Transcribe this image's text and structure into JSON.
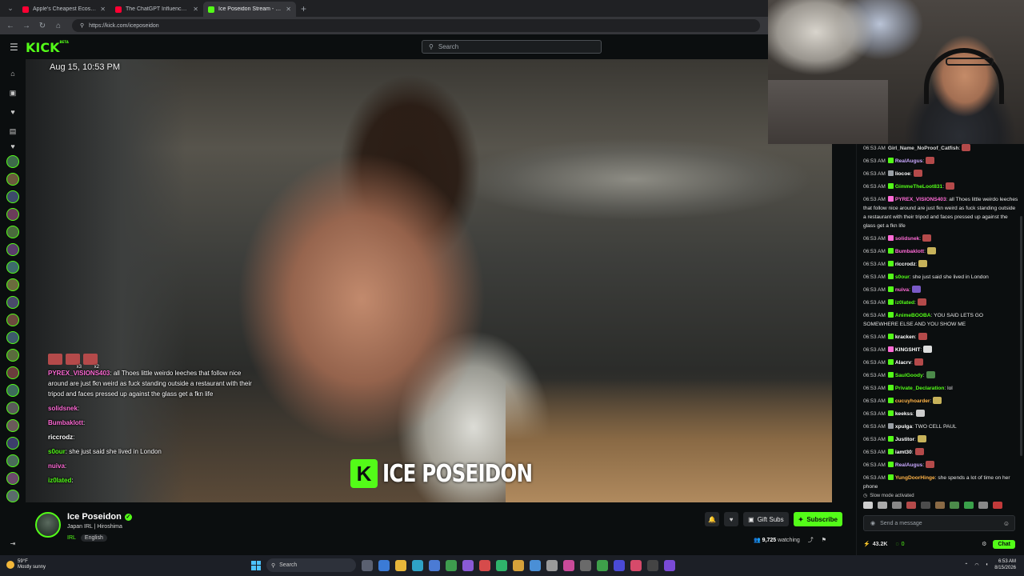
{
  "browser": {
    "tabs": [
      {
        "title": "Apple's Cheapest Ecosystem Endi...",
        "favicon_color": "#ff0033",
        "active": false
      },
      {
        "title": "The ChatGPT Influencer Trap Just...",
        "favicon_color": "#ff0033",
        "active": false
      },
      {
        "title": "Ice Poseidon Stream - Watch ...",
        "favicon_color": "#53fc18",
        "active": true
      }
    ],
    "new_tab_icon": "+",
    "url": "https://kick.com/iceposeidon"
  },
  "kick": {
    "logo": "KICK",
    "logo_sup": "BETA",
    "search_placeholder": "Search",
    "accent": "#53fc18"
  },
  "video": {
    "date_overlay": "Aug 15, 10:53 PM",
    "watermark": "ICE POSEIDON",
    "overlay_chat": [
      {
        "user": "PYREX_VISIONS403",
        "color": "#ff6bd6",
        "text": ": all Thoes little weirdo leeches that follow nice around are just fkn weird as fuck standing outside a restaurant with their tripod and faces pressed up against the glass get a fkn life"
      },
      {
        "user": "solidsnek",
        "color": "#ff6bd6",
        "text": ":"
      },
      {
        "user": "Bumbaklott",
        "color": "#ff6bd6",
        "text": ":"
      },
      {
        "user": "riccrodz",
        "color": "#ffffff",
        "text": ":"
      },
      {
        "user": "s0our",
        "color": "#53fc18",
        "text": ": she just said she lived in London"
      },
      {
        "user": "nuiva",
        "color": "#ff6bd6",
        "text": ":"
      },
      {
        "user": "iz0lated",
        "color": "#53fc18",
        "text": ":"
      }
    ],
    "overlay_emote_counts": [
      "x3",
      "x2"
    ]
  },
  "stream": {
    "name": "Ice Poseidon",
    "title": "Japan IRL | Hiroshima",
    "category": "IRL",
    "tag": "English",
    "gift_label": "Gift Subs",
    "subscribe_label": "Subscribe",
    "watching_count": "9,725",
    "watching_label": "watching"
  },
  "chat": {
    "messages": [
      {
        "ts": "06:53 AM",
        "user": "Girl_Name_NoProof_Catfish",
        "color": "#d6d6d6",
        "badge": "",
        "text": ":",
        "emote": "#b44a4a"
      },
      {
        "ts": "06:53 AM",
        "user": "RealAugus",
        "color": "#c9a9ff",
        "badge": "#53fc18",
        "text": ":",
        "emote": "#b44a4a"
      },
      {
        "ts": "06:53 AM",
        "user": "liocoe",
        "color": "#ffffff",
        "badge": "#9aa0a6",
        "text": ":",
        "emote": "#b44a4a"
      },
      {
        "ts": "06:53 AM",
        "user": "GimmeTheLoot831",
        "color": "#53fc18",
        "badge": "#53fc18",
        "text": ":",
        "emote": "#b44a4a"
      },
      {
        "ts": "06:53 AM",
        "user": "PYREX_VISIONS403",
        "color": "#ff6bd6",
        "badge": "#ff6bd6",
        "text": ": all Thoes little weirdo leeches that follow nice around are just fkn weird as fuck standing outside a restaurant with their tripod and faces pressed up against the glass get a fkn life",
        "emote": ""
      },
      {
        "ts": "06:53 AM",
        "user": "solidsnek",
        "color": "#ff6bd6",
        "badge": "#ff6bd6",
        "text": ":",
        "emote": "#b44a4a"
      },
      {
        "ts": "06:53 AM",
        "user": "Bumbaklott",
        "color": "#ff6bd6",
        "badge": "#53fc18",
        "text": ":",
        "emote": "#c7b25a"
      },
      {
        "ts": "06:53 AM",
        "user": "riccrodz",
        "color": "#ffffff",
        "badge": "#53fc18",
        "text": ":",
        "emote": "#c7b25a"
      },
      {
        "ts": "06:53 AM",
        "user": "s0our",
        "color": "#53fc18",
        "badge": "#53fc18",
        "text": ": she just said she lived in London",
        "emote": ""
      },
      {
        "ts": "06:53 AM",
        "user": "nuiva",
        "color": "#ff6bd6",
        "badge": "#53fc18",
        "text": ":",
        "emote": "#7a5ac7"
      },
      {
        "ts": "06:53 AM",
        "user": "iz0lated",
        "color": "#53fc18",
        "badge": "#53fc18",
        "text": ":",
        "emote": "#b44a4a"
      },
      {
        "ts": "06:53 AM",
        "user": "AnimeBOOBA",
        "color": "#53fc18",
        "badge": "#53fc18",
        "text": ": YOU SAID LETS GO SOMEWHERE ELSE AND YOU SHOW ME",
        "emote": ""
      },
      {
        "ts": "06:53 AM",
        "user": "kracken",
        "color": "#ffffff",
        "badge": "#53fc18",
        "text": ":",
        "emote": "#b44a4a"
      },
      {
        "ts": "06:53 AM",
        "user": "KINGSHIT",
        "color": "#ffffff",
        "badge": "#ff6bd6",
        "text": ":",
        "emote": "#dddddd"
      },
      {
        "ts": "06:53 AM",
        "user": "Alacrv",
        "color": "#ffffff",
        "badge": "#53fc18",
        "text": ":",
        "emote": "#b44a4a"
      },
      {
        "ts": "06:53 AM",
        "user": "SaulGoody",
        "color": "#53fc18",
        "badge": "#53fc18",
        "text": ":",
        "emote": "#4c8a4a"
      },
      {
        "ts": "06:53 AM",
        "user": "Private_Declaration",
        "color": "#53fc18",
        "badge": "#53fc18",
        "text": ": lol",
        "emote": ""
      },
      {
        "ts": "06:53 AM",
        "user": "cucuyhoarder",
        "color": "#ffb347",
        "badge": "#53fc18",
        "text": ":",
        "emote": "#c7b25a"
      },
      {
        "ts": "06:53 AM",
        "user": "keekss",
        "color": "#ffffff",
        "badge": "#53fc18",
        "text": ":",
        "emote": "#cccccc"
      },
      {
        "ts": "06:53 AM",
        "user": "xpulga",
        "color": "#ffffff",
        "badge": "#9aa0a6",
        "text": ": TWO CELL PAUL",
        "emote": ""
      },
      {
        "ts": "06:53 AM",
        "user": "Justitor",
        "color": "#ffffff",
        "badge": "#53fc18",
        "text": ":",
        "emote": "#c7b25a"
      },
      {
        "ts": "06:53 AM",
        "user": "iamt30",
        "color": "#ffffff",
        "badge": "#53fc18",
        "text": ":",
        "emote": "#b44a4a"
      },
      {
        "ts": "06:53 AM",
        "user": "RealAugus",
        "color": "#c9a9ff",
        "badge": "#53fc18",
        "text": ":",
        "emote": "#b44a4a"
      },
      {
        "ts": "06:53 AM",
        "user": "YungDoorHinge",
        "color": "#ffb347",
        "badge": "#53fc18",
        "text": ": she spends a lot of time on her phone",
        "emote": ""
      }
    ],
    "slow_mode_label": "Slow mode activated",
    "input_placeholder": "Send a message",
    "points": "43.2K",
    "green_count": "0",
    "chat_button": "Chat"
  },
  "taskbar": {
    "weather_temp": "59°F",
    "weather_desc": "Mostly sunny",
    "search_label": "Search",
    "time": "6:53 AM",
    "date": "8/15/2026"
  }
}
